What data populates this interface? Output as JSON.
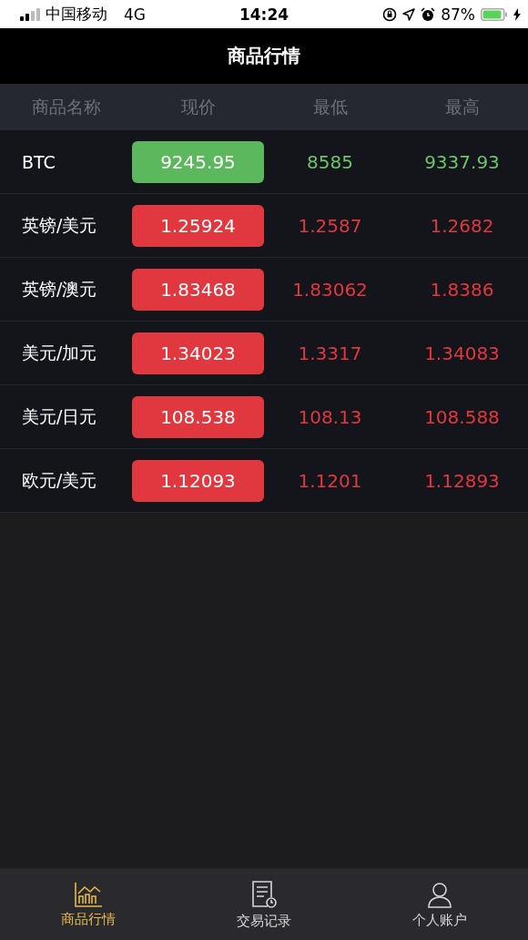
{
  "status_bar": {
    "carrier": "中国移动",
    "network": "4G",
    "time": "14:24",
    "battery": "87%"
  },
  "header": {
    "title": "商品行情"
  },
  "table": {
    "columns": [
      "商品名称",
      "现价",
      "最低",
      "最高"
    ],
    "rows": [
      {
        "name": "BTC",
        "price": "9245.95",
        "low": "8585",
        "high": "9337.93",
        "kind": "up"
      },
      {
        "name": "英镑/美元",
        "price": "1.25924",
        "low": "1.2587",
        "high": "1.2682",
        "kind": "down"
      },
      {
        "name": "英镑/澳元",
        "price": "1.83468",
        "low": "1.83062",
        "high": "1.8386",
        "kind": "down"
      },
      {
        "name": "美元/加元",
        "price": "1.34023",
        "low": "1.3317",
        "high": "1.34083",
        "kind": "down"
      },
      {
        "name": "美元/日元",
        "price": "108.538",
        "low": "108.13",
        "high": "108.588",
        "kind": "down"
      },
      {
        "name": "欧元/美元",
        "price": "1.12093",
        "low": "1.1201",
        "high": "1.12893",
        "kind": "down"
      }
    ]
  },
  "tab_bar": [
    {
      "label": "商品行情",
      "kind": "chart",
      "selected": true
    },
    {
      "label": "交易记录",
      "kind": "record",
      "selected": false
    },
    {
      "label": "个人账户",
      "kind": "person",
      "selected": false
    }
  ]
}
